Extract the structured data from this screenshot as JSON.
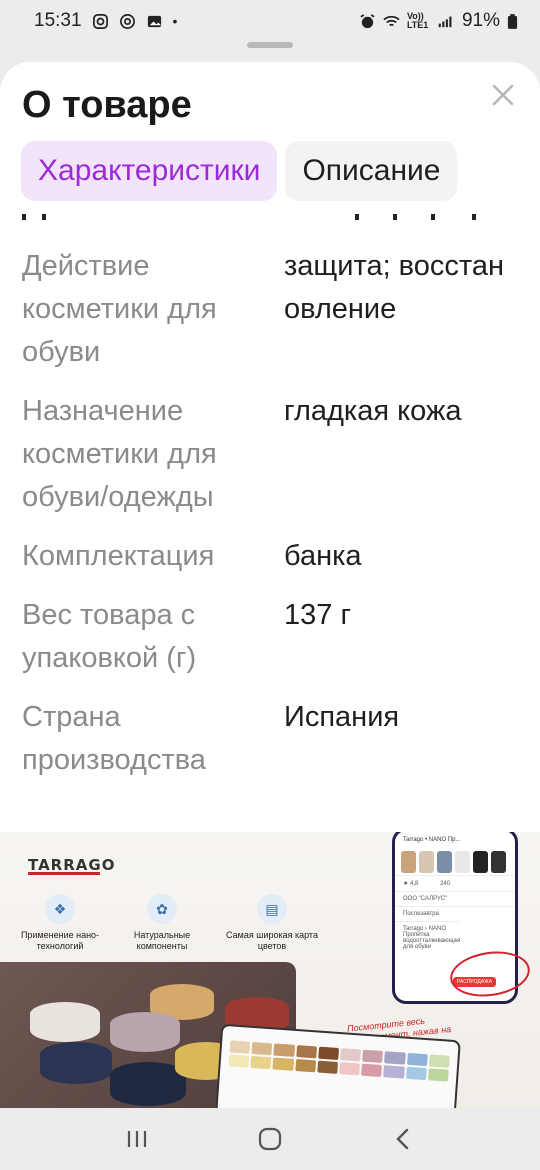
{
  "status_bar": {
    "time": "15:31",
    "network": "Vo)) LTE1",
    "battery": "91%"
  },
  "sheet": {
    "title": "О товаре",
    "tabs": [
      {
        "label": "Характеристики",
        "active": true
      },
      {
        "label": "Описание",
        "active": false
      }
    ]
  },
  "specs": [
    {
      "label": "Действие косметики для обуви",
      "value": "защита; восстановление"
    },
    {
      "label": "Назначение косметики для обуви/одежды",
      "value": "гладкая кожа"
    },
    {
      "label": "Комплектация",
      "value": "банка"
    },
    {
      "label": "Вес товара с упаковкой (г)",
      "value": "137 г"
    },
    {
      "label": "Страна производства",
      "value": "Испания"
    }
  ],
  "banner": {
    "brand": "TARRAGO",
    "features": [
      {
        "text": "Применение нано-технологий"
      },
      {
        "text": "Натуральные компоненты"
      },
      {
        "text": "Самая широкая карта цветов"
      }
    ],
    "phone": {
      "header": "Tarrago • NANO Пр...",
      "rating": "4,8",
      "questions": "240",
      "seller": "ООО \"САЛРУС\"",
      "delivery": "Послезавтра",
      "item": "Tarrago › NANO Пропитка водоотталкивающая для обуви",
      "sale": "РАСПРОДАЖА"
    },
    "caption": "Посмотрите весь ассортимент, нажав на логотип бренда"
  },
  "colors": {
    "accent": "#9c2bd6",
    "accent_bg": "#f2e4fb",
    "label_gray": "#8a8a8f"
  }
}
